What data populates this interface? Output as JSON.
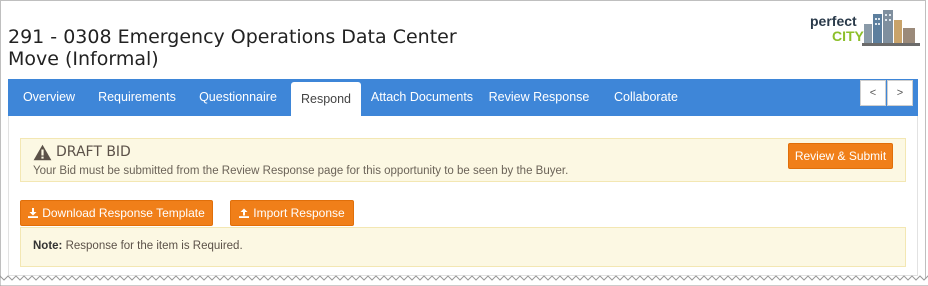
{
  "header": {
    "title_line1": "291 - 0308 Emergency Operations Data Center",
    "title_line2": "Move (Informal)",
    "logo_text_top": "perfect",
    "logo_text_bottom": "CITY"
  },
  "tabs": [
    {
      "label": "Overview",
      "active": false
    },
    {
      "label": "Requirements",
      "active": false
    },
    {
      "label": "Questionnaire",
      "active": false
    },
    {
      "label": "Respond",
      "active": true
    },
    {
      "label": "Attach Documents",
      "active": false
    },
    {
      "label": "Review Response",
      "active": false
    },
    {
      "label": "Collaborate",
      "active": false
    }
  ],
  "pager": {
    "prev": "<",
    "next": ">"
  },
  "draft": {
    "title": "DRAFT BID",
    "message": "Your Bid must be submitted from the Review Response page for this opportunity to be seen by the Buyer.",
    "submit_label": "Review & Submit",
    "icon": "warning-icon"
  },
  "actions": {
    "download_label": "Download Response Template",
    "import_label": "Import Response",
    "download_icon": "download-icon",
    "import_icon": "upload-icon"
  },
  "note": {
    "label": "Note:",
    "text": " Response for the item is Required."
  },
  "colors": {
    "nav": "#3e86d8",
    "accent": "#f07f19",
    "alert_bg": "#fcf8e3"
  }
}
